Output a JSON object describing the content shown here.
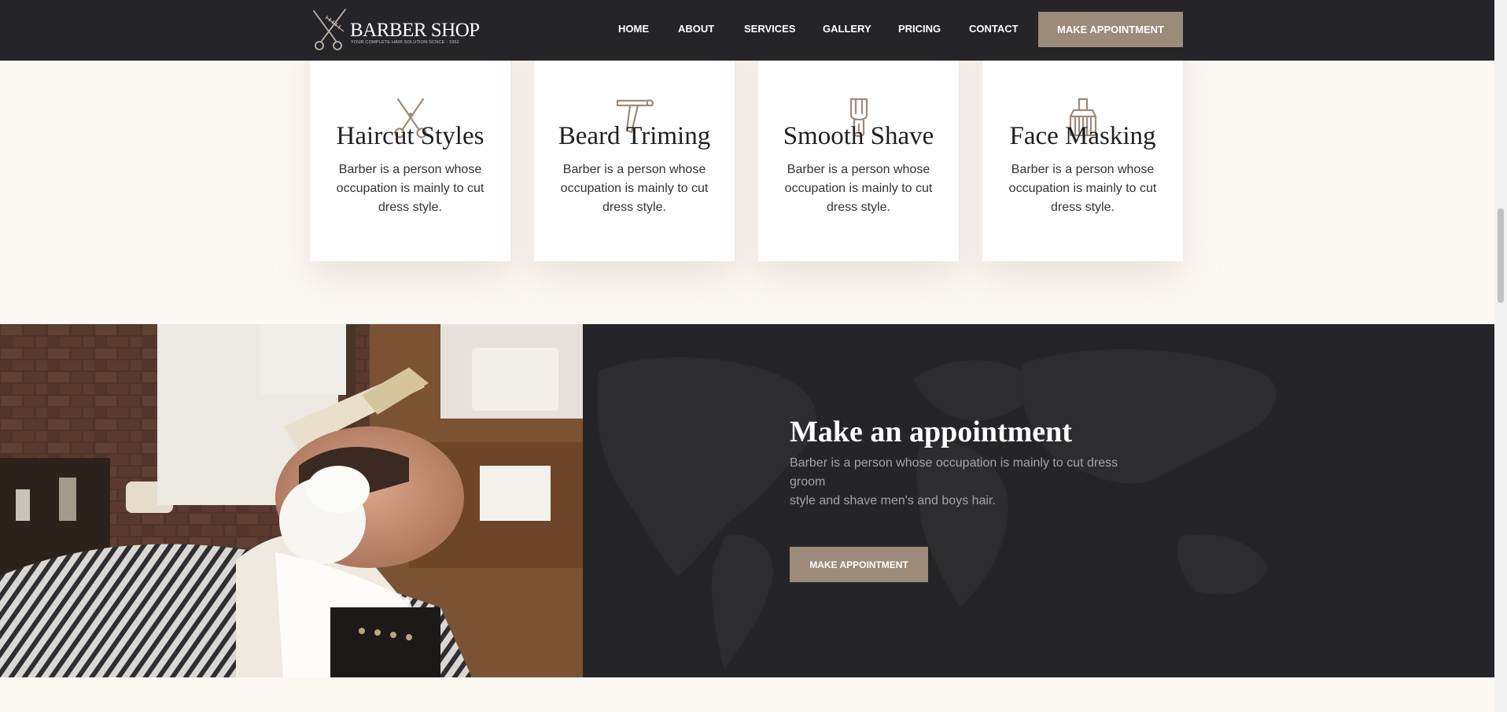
{
  "header": {
    "logo": {
      "title": "BARBER SHOP",
      "tagline": "YOUR COMPLETE HAIR SOLUTION SCNCE - 1952"
    },
    "nav": [
      {
        "label": "HOME"
      },
      {
        "label": "ABOUT"
      },
      {
        "label": "SERVICES"
      },
      {
        "label": "GALLERY"
      },
      {
        "label": "PRICING"
      },
      {
        "label": "CONTACT"
      }
    ],
    "cta_label": "MAKE APPOINTMENT"
  },
  "services": {
    "cards": [
      {
        "icon": "scissors-icon",
        "title": "Haircut Styles",
        "description": "Barber is a person whose occupation is mainly to cut dress style."
      },
      {
        "icon": "razor-icon",
        "title": "Beard Triming",
        "description": "Barber is a person whose occupation is mainly to cut dress style."
      },
      {
        "icon": "shaving-brush-icon",
        "title": "Smooth Shave",
        "description": "Barber is a person whose occupation is mainly to cut dress style."
      },
      {
        "icon": "face-mask-brush-icon",
        "title": "Face Masking",
        "description": "Barber is a person whose occupation is mainly to cut dress style."
      }
    ]
  },
  "appointment": {
    "title": "Make an appointment",
    "text_line1": "Barber is a person whose occupation is mainly to cut dress groom",
    "text_line2": "style and shave men's and boys hair.",
    "cta_label": "MAKE APPOINTMENT",
    "photo_icon": "barber-shaving-photo"
  },
  "colors": {
    "header_bg": "#252428",
    "accent": "#9c8b79",
    "page_bg": "#fcf9f5",
    "card_bg": "#ffffff",
    "icon_stroke": "#9c8b79"
  }
}
